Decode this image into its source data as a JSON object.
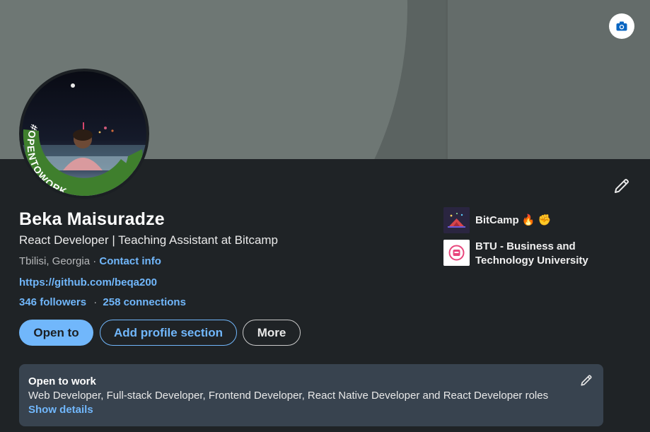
{
  "profile": {
    "name": "Beka Maisuradze",
    "headline": "React Developer | Teaching Assistant at Bitcamp",
    "location": "Tbilisi, Georgia",
    "location_separator": "·",
    "contact_info": "Contact info",
    "website": "https://github.com/beqa200",
    "followers": "346 followers",
    "network_separator": "·",
    "connections": "258 connections",
    "avatar_frame_text": "#OPENTOWORK"
  },
  "actions": {
    "open_to": "Open to",
    "add_section": "Add profile section",
    "more": "More"
  },
  "organizations": [
    {
      "name": "BitCamp",
      "emoji": "🔥 ✊",
      "logo": "bitcamp-logo"
    },
    {
      "name": "BTU - Business and Technology University",
      "logo": "btu-logo"
    }
  ],
  "open_to_work": {
    "title": "Open to work",
    "roles": "Web Developer, Full-stack Developer, Frontend Developer, React Native Developer and React Developer roles",
    "show_details": "Show details"
  },
  "icons": {
    "camera": "camera-icon",
    "edit": "pencil-icon"
  },
  "colors": {
    "accent": "#71b7fb",
    "open_to_work_green": "#3a7d2a",
    "card_background": "#1f2326",
    "panel_background": "#38434f"
  }
}
